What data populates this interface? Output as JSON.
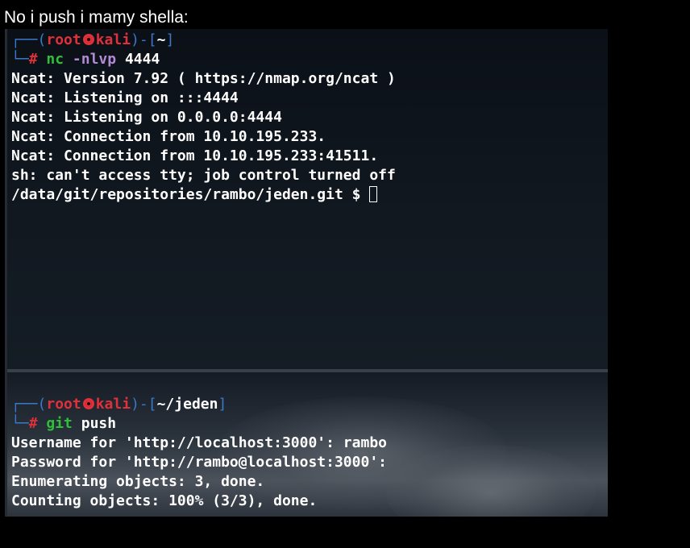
{
  "caption": "No i push i mamy shella:",
  "top_pane": {
    "prompt": {
      "frame_open": "┌──(",
      "user": "root",
      "host": "kali",
      "frame_mid": ")-[",
      "path": "~",
      "frame_close": "]",
      "corner": "└─",
      "hash": "#",
      "cmd": "nc",
      "opt": "-nlvp",
      "arg": "4444"
    },
    "output": [
      "Ncat: Version 7.92 ( https://nmap.org/ncat )",
      "Ncat: Listening on :::4444",
      "Ncat: Listening on 0.0.0.0:4444",
      "Ncat: Connection from 10.10.195.233.",
      "Ncat: Connection from 10.10.195.233:41511.",
      "sh: can't access tty; job control turned off"
    ],
    "shell_prompt": "/data/git/repositories/rambo/jeden.git $ "
  },
  "bottom_pane": {
    "prompt": {
      "frame_open": "┌──(",
      "user": "root",
      "host": "kali",
      "frame_mid": ")-[",
      "path": "~/jeden",
      "frame_close": "]",
      "corner": "└─",
      "hash": "#",
      "cmd": "git",
      "arg": "push"
    },
    "output": [
      "Username for 'http://localhost:3000': rambo",
      "Password for 'http://rambo@localhost:3000':",
      "Enumerating objects: 3, done.",
      "Counting objects: 100% (3/3), done."
    ]
  },
  "icons": {
    "prompt_symbol": "kali-skull-icon"
  }
}
